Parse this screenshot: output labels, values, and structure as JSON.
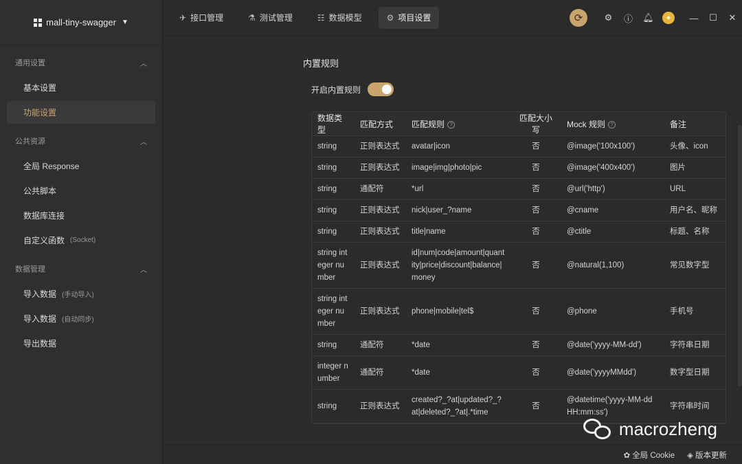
{
  "project": {
    "name": "mall-tiny-swagger"
  },
  "sidebar": {
    "groups": [
      {
        "title": "通用设置",
        "items": [
          {
            "label": "基本设置"
          },
          {
            "label": "功能设置"
          }
        ]
      },
      {
        "title": "公共资源",
        "items": [
          {
            "label": "全局 Response"
          },
          {
            "label": "公共脚本"
          },
          {
            "label": "数据库连接"
          },
          {
            "label": "自定义函数",
            "sub": "(Socket)"
          }
        ]
      },
      {
        "title": "数据管理",
        "items": [
          {
            "label": "导入数据",
            "sub": "(手动导入)"
          },
          {
            "label": "导入数据",
            "sub": "(自动同步)"
          },
          {
            "label": "导出数据"
          }
        ]
      }
    ]
  },
  "tabs": [
    {
      "label": "接口管理"
    },
    {
      "label": "测试管理"
    },
    {
      "label": "数据模型"
    },
    {
      "label": "项目设置"
    }
  ],
  "main": {
    "section_title": "内置规则",
    "toggle_label": "开启内置规则",
    "toggle_on": true
  },
  "table": {
    "headers": [
      "数据类型",
      "匹配方式",
      "匹配规则",
      "匹配大小写",
      "Mock 规则",
      "备注"
    ],
    "rows": [
      [
        "string",
        "正则表达式",
        "avatar|icon",
        "否",
        "@image('100x100')",
        "头像、icon"
      ],
      [
        "string",
        "正则表达式",
        "image|img|photo|pic",
        "否",
        "@image('400x400')",
        "图片"
      ],
      [
        "string",
        "通配符",
        "*url",
        "否",
        "@url('http')",
        "URL"
      ],
      [
        "string",
        "正则表达式",
        "nick|user_?name",
        "否",
        "@cname",
        "用户名、昵称"
      ],
      [
        "string",
        "正则表达式",
        "title|name",
        "否",
        "@ctitle",
        "标题、名称"
      ],
      [
        "string integer number",
        "正则表达式",
        "id|num|code|amount|quantity|price|discount|balance|money",
        "否",
        "@natural(1,100)",
        "常见数字型"
      ],
      [
        "string integer number",
        "正则表达式",
        "phone|mobile|tel$",
        "否",
        "@phone",
        "手机号"
      ],
      [
        "string",
        "通配符",
        "*date",
        "否",
        "@date('yyyy-MM-dd')",
        "字符串日期"
      ],
      [
        "integer number",
        "通配符",
        "*date",
        "否",
        "@date('yyyyMMdd')",
        "数字型日期"
      ],
      [
        "string",
        "正则表达式",
        "created?_?at|updated?_?at|deleted?_?at|.*time",
        "否",
        "@datetime('yyyy-MM-dd HH:mm:ss')",
        "字符串时间"
      ]
    ]
  },
  "footer": {
    "cookie": "全局 Cookie",
    "update": "版本更新"
  },
  "watermark": {
    "text": "macrozheng"
  },
  "colors": {
    "accent": "#c9a46c",
    "background": "#2b2b2b",
    "sidebar": "#2f2f2f"
  }
}
